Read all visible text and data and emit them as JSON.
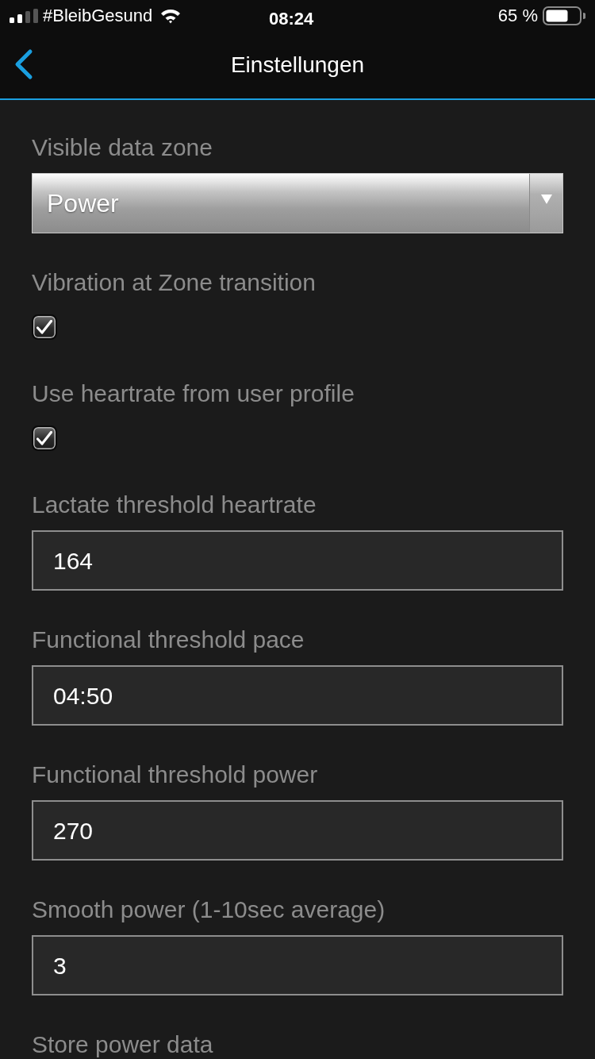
{
  "status_bar": {
    "carrier": "#BleibGesund",
    "time": "08:24",
    "battery": "65 %"
  },
  "nav": {
    "title": "Einstellungen"
  },
  "settings": [
    {
      "kind": "select",
      "label": "Visible data zone",
      "value": "Power"
    },
    {
      "kind": "checkbox",
      "label": "Vibration at Zone transition",
      "checked": true
    },
    {
      "kind": "checkbox",
      "label": "Use heartrate from user profile",
      "checked": true
    },
    {
      "kind": "input",
      "label": "Lactate threshold heartrate",
      "value": "164"
    },
    {
      "kind": "input",
      "label": "Functional threshold pace",
      "value": "04:50"
    },
    {
      "kind": "input",
      "label": "Functional threshold power",
      "value": "270"
    },
    {
      "kind": "input",
      "label": "Smooth power (1-10sec average)",
      "value": "3"
    },
    {
      "kind": "label",
      "label": "Store power data"
    }
  ]
}
